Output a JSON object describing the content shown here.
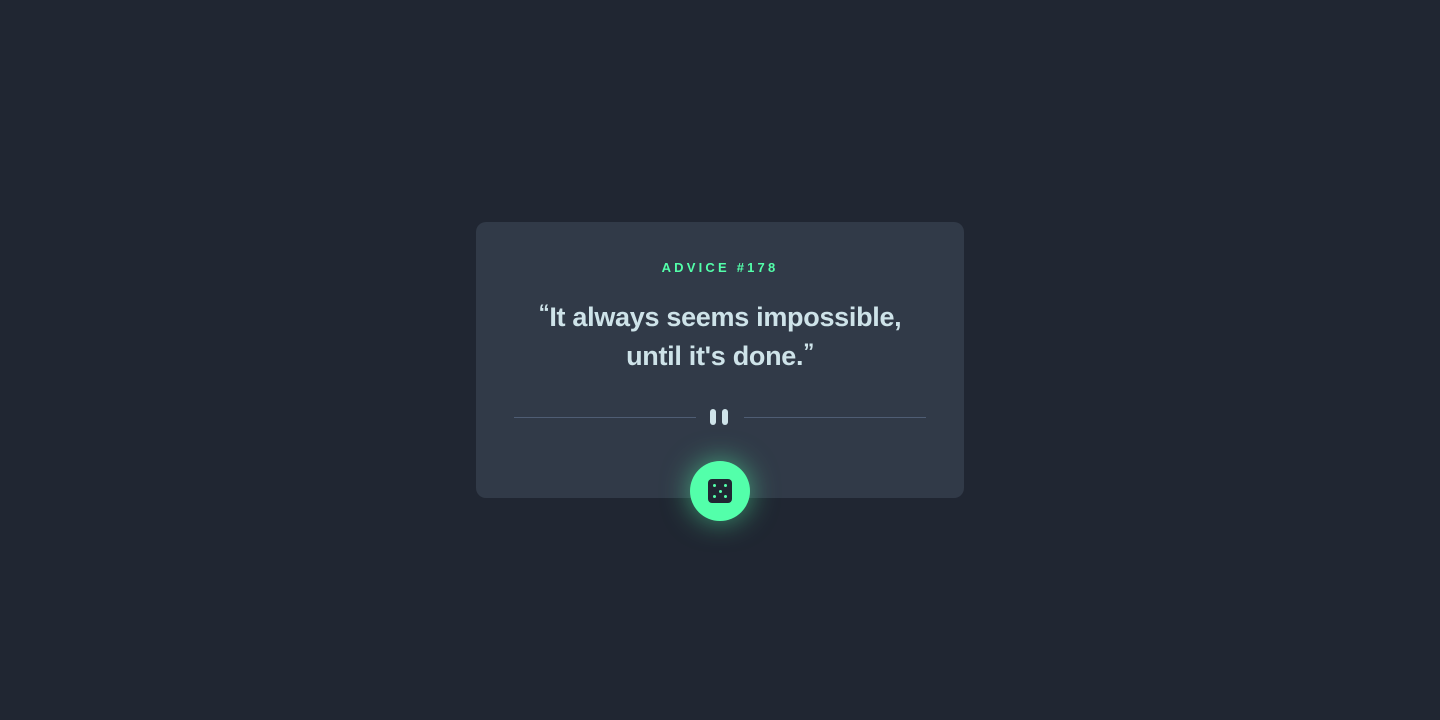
{
  "advice": {
    "label": "ADVICE #178",
    "open_quote": "“",
    "text": "It always seems impossible, until it's done.",
    "close_quote": "”"
  },
  "divider": {
    "icon": "pause-icon"
  },
  "dice_button": {
    "icon": "dice-icon"
  },
  "colors": {
    "background": "#202632",
    "card": "#313a48",
    "accent": "#53ffaa",
    "text": "#cee3e9",
    "divider_line": "#4f5d74"
  }
}
